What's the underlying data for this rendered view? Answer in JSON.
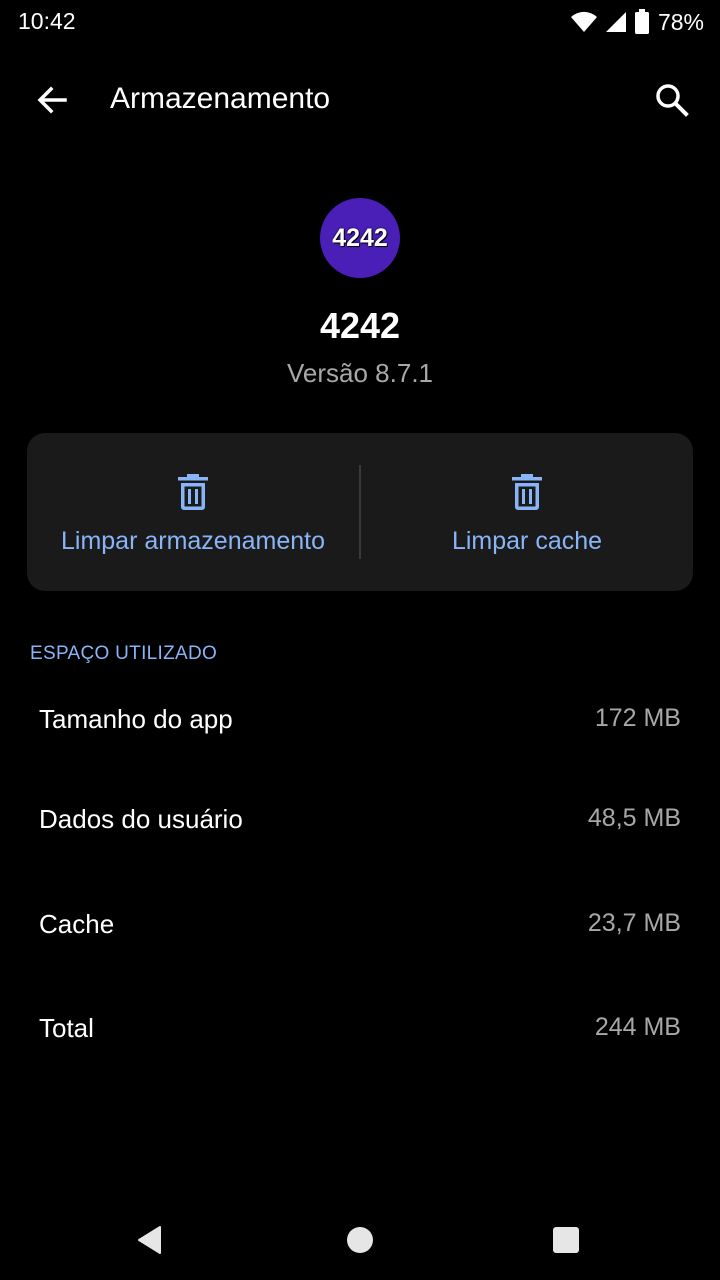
{
  "status_bar": {
    "time": "10:42",
    "battery": "78%",
    "icons": [
      "wifi-icon",
      "signal-icon",
      "battery-icon"
    ]
  },
  "app_bar": {
    "title": "Armazenamento",
    "back_icon": "arrow-back-icon",
    "search_icon": "search-icon"
  },
  "app": {
    "icon_text": "4242",
    "name": "4242",
    "version": "Versão 8.7.1",
    "icon_color": "#4a1fb8"
  },
  "actions": {
    "clear_storage": "Limpar armazenamento",
    "clear_cache": "Limpar cache",
    "icon": "trash-icon",
    "accent_color": "#8ab4f8"
  },
  "usage": {
    "header": "ESPAÇO UTILIZADO",
    "rows": [
      {
        "label": "Tamanho do app",
        "value": "172 MB"
      },
      {
        "label": "Dados do usuário",
        "value": "48,5 MB"
      },
      {
        "label": "Cache",
        "value": "23,7 MB"
      },
      {
        "label": "Total",
        "value": "244 MB"
      }
    ]
  },
  "nav_bar": {
    "icons": [
      "back-triangle-icon",
      "home-circle-icon",
      "recents-square-icon"
    ]
  }
}
